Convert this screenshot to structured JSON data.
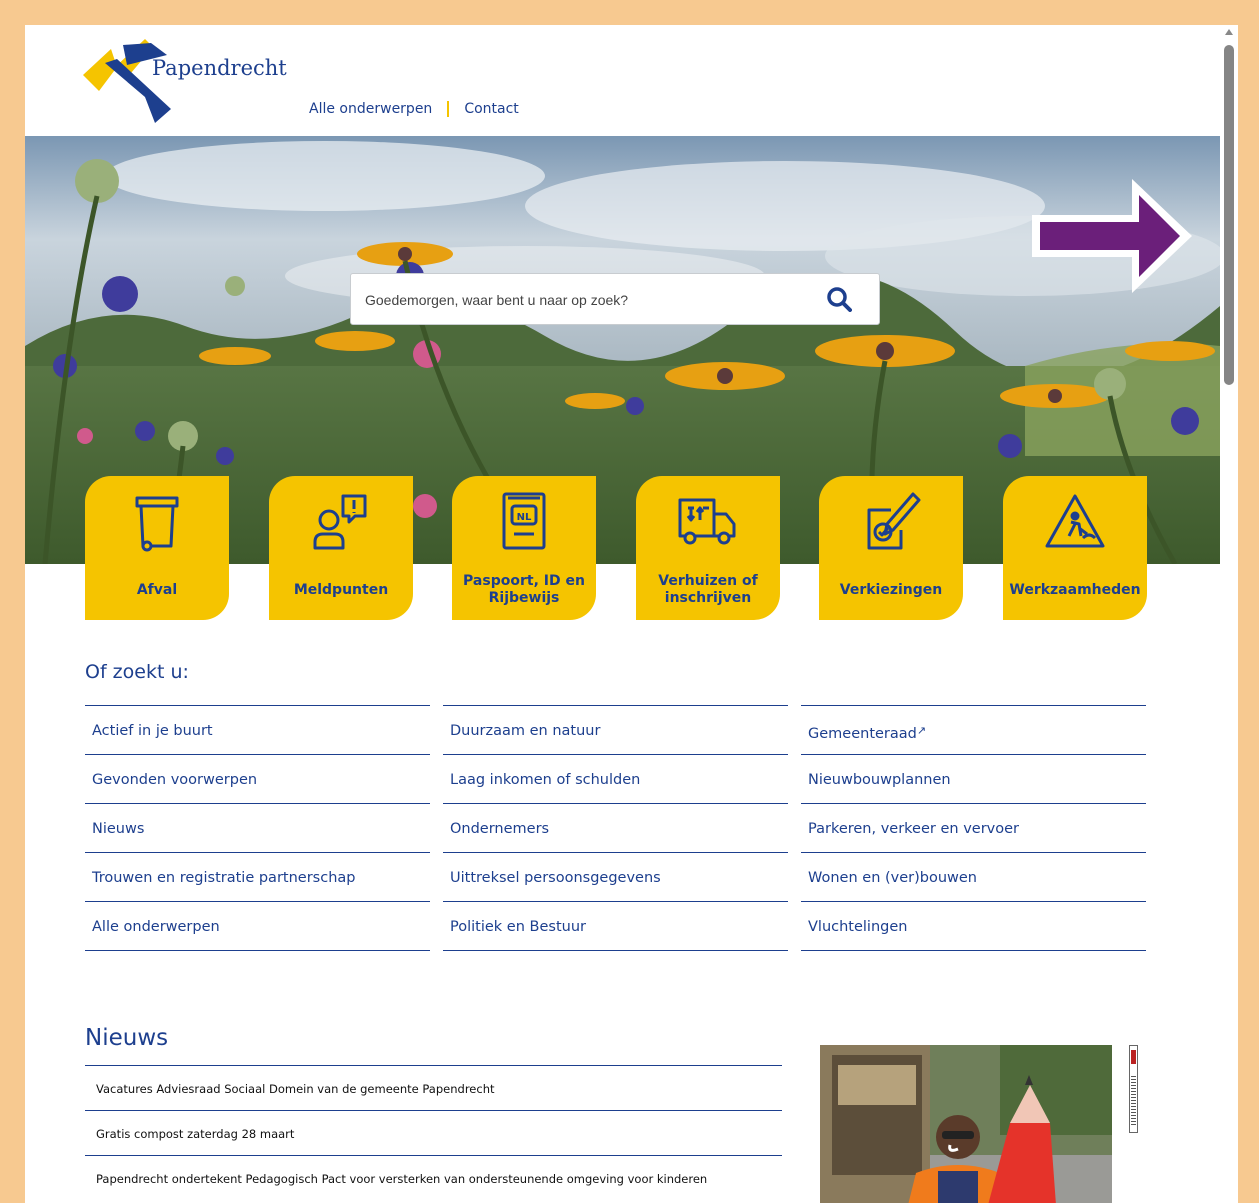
{
  "header": {
    "logo_text": "Papendrecht",
    "nav": [
      "Alle onderwerpen",
      "Contact"
    ]
  },
  "search": {
    "placeholder": "Goedemorgen, waar bent u naar op zoek?",
    "icon": "search-icon"
  },
  "tiles": [
    {
      "label": "Afval",
      "icon": "waste-bin-icon"
    },
    {
      "label": "Meldpunten",
      "icon": "report-person-icon"
    },
    {
      "label": "Paspoort, ID en Rijbewijs",
      "icon": "passport-icon"
    },
    {
      "label": "Verhuizen of inschrijven",
      "icon": "moving-truck-icon"
    },
    {
      "label": "Verkiezingen",
      "icon": "ballot-vote-icon"
    },
    {
      "label": "Werkzaamheden",
      "icon": "roadwork-sign-icon"
    }
  ],
  "ofzoekt": {
    "title": "Of zoekt u:",
    "columns": [
      [
        "Actief in je buurt",
        "Gevonden voorwerpen",
        "Nieuws",
        "Trouwen en registratie partnerschap",
        "Alle onderwerpen"
      ],
      [
        "Duurzaam en natuur",
        "Laag inkomen of schulden",
        "Ondernemers",
        "Uittreksel persoonsgegevens",
        "Politiek en Bestuur"
      ],
      [
        "Gemeenteraad",
        "Nieuwbouwplannen",
        "Parkeren, verkeer en vervoer",
        "Wonen en (ver)bouwen",
        "Vluchtelingen"
      ]
    ],
    "external_mark": "↗"
  },
  "nieuws": {
    "title": "Nieuws",
    "items": [
      "Vacatures Adviesraad Sociaal Domein van de gemeente Papendrecht",
      "Gratis compost zaterdag 28 maart",
      "Papendrecht ondertekent Pedagogisch Pact voor versterken van ondersteunende omgeving voor kinderen"
    ]
  },
  "colors": {
    "brand_blue": "#1d3f8e",
    "brand_yellow": "#f5c400",
    "annotation_arrow": "#6b1f7a",
    "page_border": "#f7c990"
  }
}
